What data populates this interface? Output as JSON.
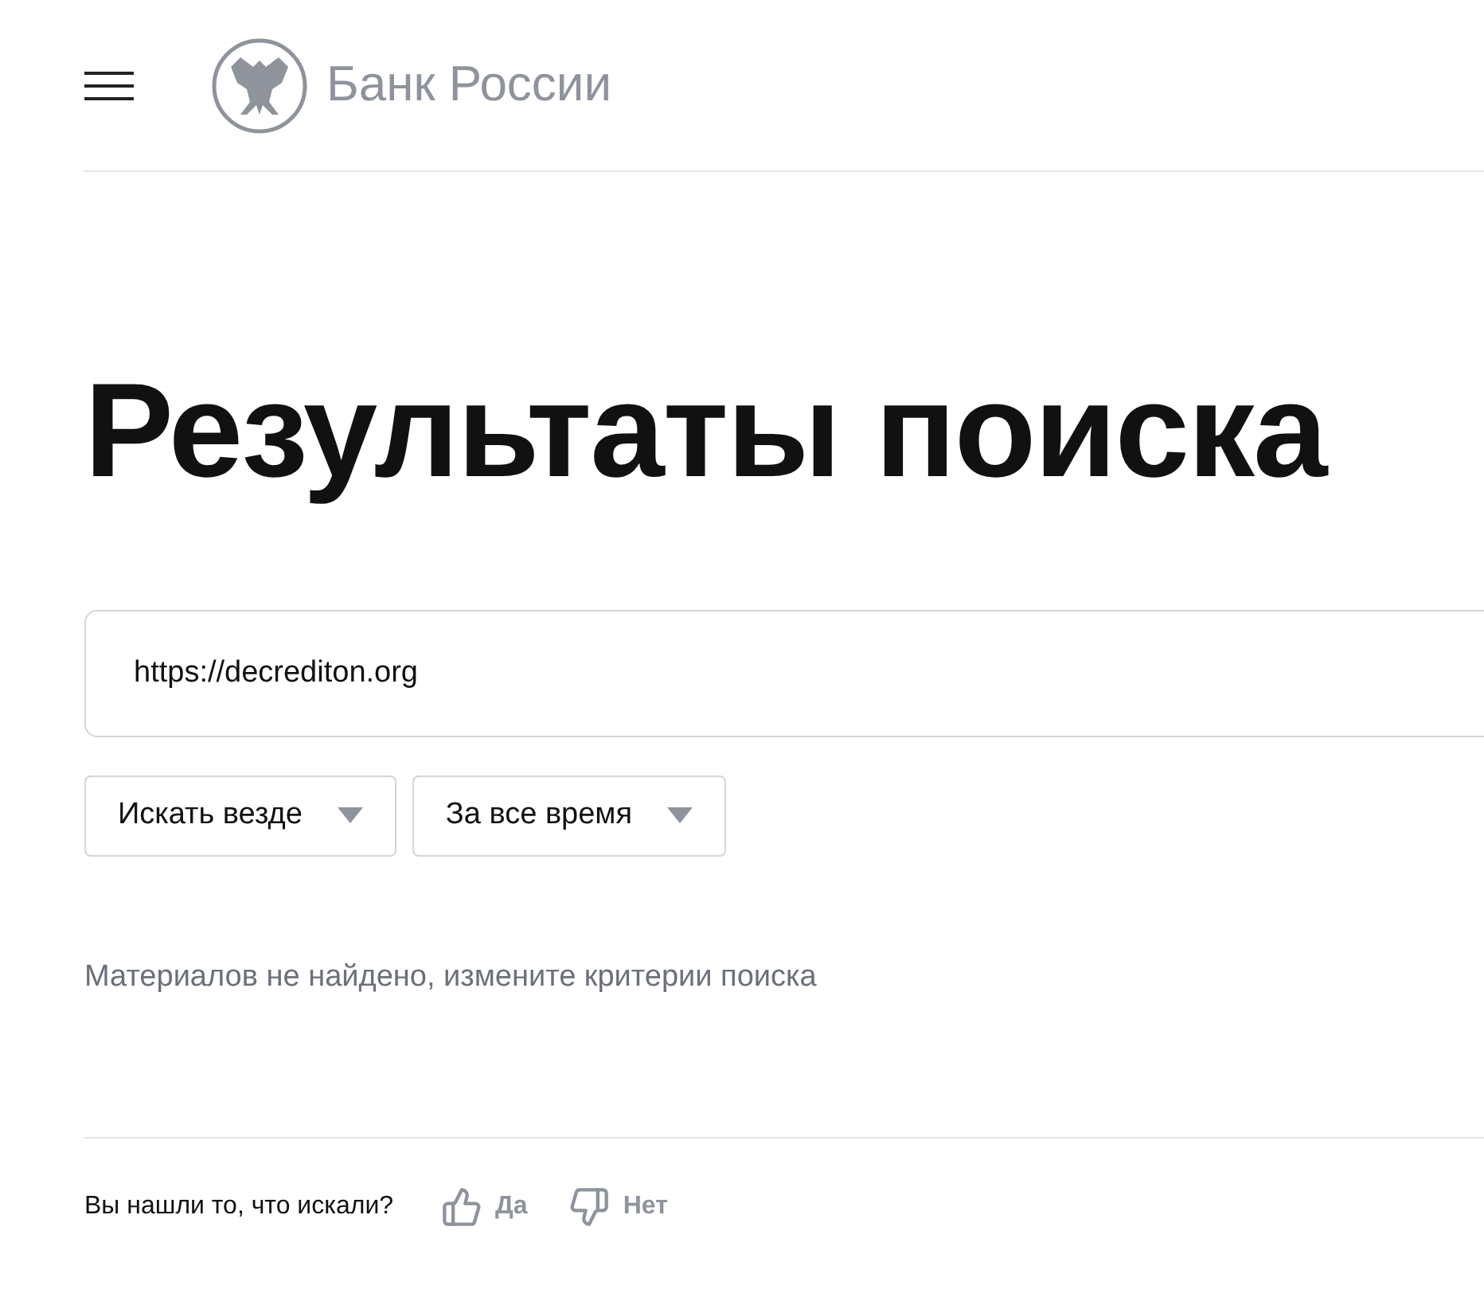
{
  "header": {
    "logo_text": "Банк России"
  },
  "title": "Результаты поиска",
  "search": {
    "value": "https://decrediton.org"
  },
  "filters": [
    {
      "label": "Искать везде"
    },
    {
      "label": "За все время"
    }
  ],
  "message": "Материалов не найдено, измените критерии поиска",
  "feedback": {
    "question": "Вы нашли то, что искали?",
    "yes": "Да",
    "no": "Нет"
  }
}
